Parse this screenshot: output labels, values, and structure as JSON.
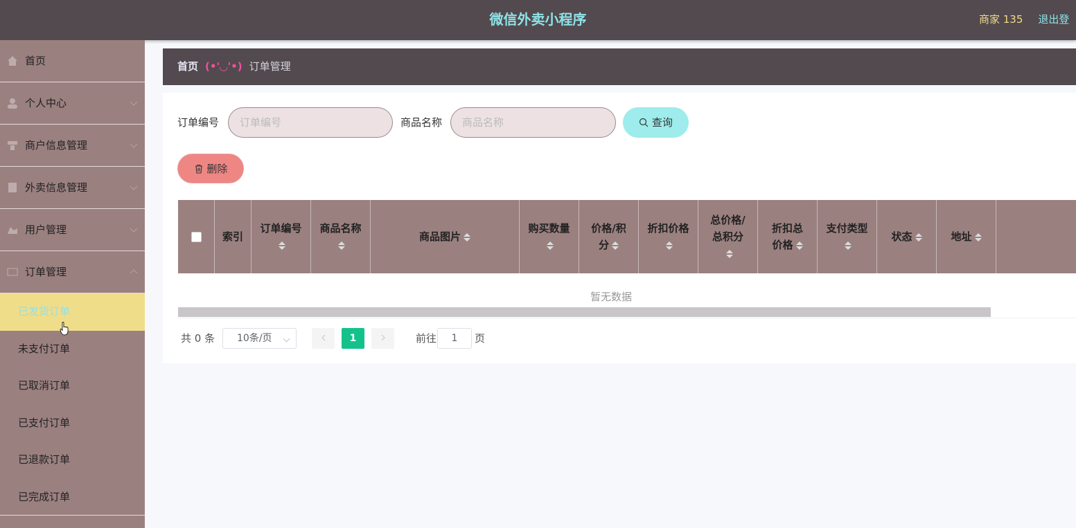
{
  "header": {
    "title": "微信外卖小程序",
    "user": "商家 135",
    "logout": "退出登"
  },
  "sidebar": {
    "items": [
      {
        "label": "首页",
        "icon": "home-icon"
      },
      {
        "label": "个人中心",
        "icon": "user-icon"
      },
      {
        "label": "商户信息管理",
        "icon": "shop-icon"
      },
      {
        "label": "外卖信息管理",
        "icon": "food-icon"
      },
      {
        "label": "用户管理",
        "icon": "users-icon"
      },
      {
        "label": "订单管理",
        "icon": "order-icon"
      }
    ],
    "sub_items": [
      "已发货订单",
      "未支付订单",
      "已取消订单",
      "已支付订单",
      "已退款订单",
      "已完成订单"
    ]
  },
  "breadcrumb": {
    "home": "首页",
    "separator": "(•'◡'•)",
    "current": "订单管理"
  },
  "search": {
    "order_no_label": "订单编号",
    "order_no_placeholder": "订单编号",
    "product_label": "商品名称",
    "product_placeholder": "商品名称",
    "query_button": "查询",
    "delete_button": "删除"
  },
  "table": {
    "columns": [
      "索引",
      "订单编号",
      "商品名称",
      "商品图片",
      "购买数量",
      "价格/积分",
      "折扣价格",
      "总价格/总积分",
      "折扣总价格",
      "支付类型",
      "状态",
      "地址"
    ],
    "empty_text": "暂无数据"
  },
  "pagination": {
    "total": "共 0 条",
    "page_size": "10条/页",
    "current_page": "1",
    "goto_label": "前往",
    "goto_value": "1",
    "page_suffix": "页"
  },
  "colors": {
    "topbar": "#524a4e",
    "sidebar": "#9b8080",
    "active_menu": "#f0dd8a",
    "accent": "#8ee3e8",
    "page_active": "#13c28a"
  }
}
